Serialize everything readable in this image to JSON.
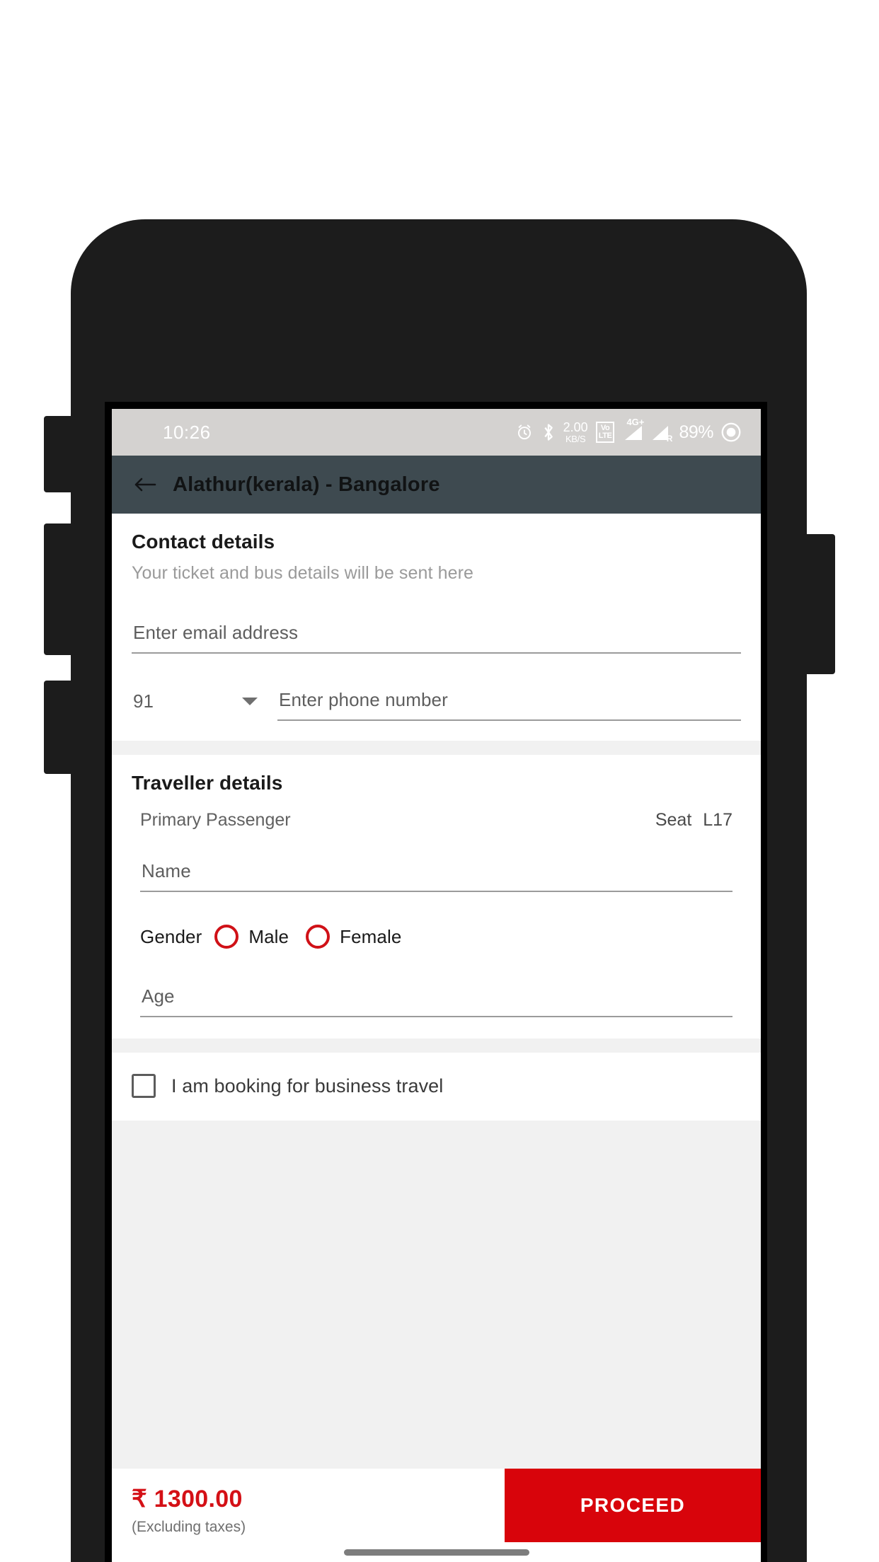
{
  "status_bar": {
    "time": "10:26",
    "data_rate_value": "2.00",
    "data_rate_unit": "KB/S",
    "volte_line1": "Vo",
    "volte_line2": "LTE",
    "network_label": "4G+",
    "roaming_label": "R",
    "battery": "89%",
    "icons": [
      "alarm-icon",
      "bluetooth-icon",
      "data-rate-icon",
      "volte-icon",
      "signal-4g-icon",
      "signal-roaming-icon",
      "battery-icon"
    ]
  },
  "app_bar": {
    "back_icon": "back-arrow-icon",
    "title": "Alathur(kerala) - Bangalore"
  },
  "contact": {
    "title": "Contact details",
    "subtitle": "Your ticket and bus details will be sent here",
    "email_placeholder": "Enter email address",
    "email_value": "",
    "country_code": "91",
    "phone_placeholder": "Enter phone number",
    "phone_value": ""
  },
  "traveller": {
    "title": "Traveller details",
    "passenger_label": "Primary Passenger",
    "seat_label": "Seat",
    "seat_number": "L17",
    "name_placeholder": "Name",
    "name_value": "",
    "gender_label": "Gender",
    "gender_male": "Male",
    "gender_female": "Female",
    "age_placeholder": "Age",
    "age_value": ""
  },
  "business": {
    "label": "I am booking for business travel",
    "checked": false
  },
  "bottom": {
    "price": "₹ 1300.00",
    "price_note": "(Excluding taxes)",
    "proceed_label": "PROCEED"
  },
  "colors": {
    "accent_red": "#d8040b",
    "price_red": "#d41016",
    "app_bar": "#3e4a50",
    "status_bar": "#d4d2d0",
    "page_bg": "#f1f1f1"
  }
}
